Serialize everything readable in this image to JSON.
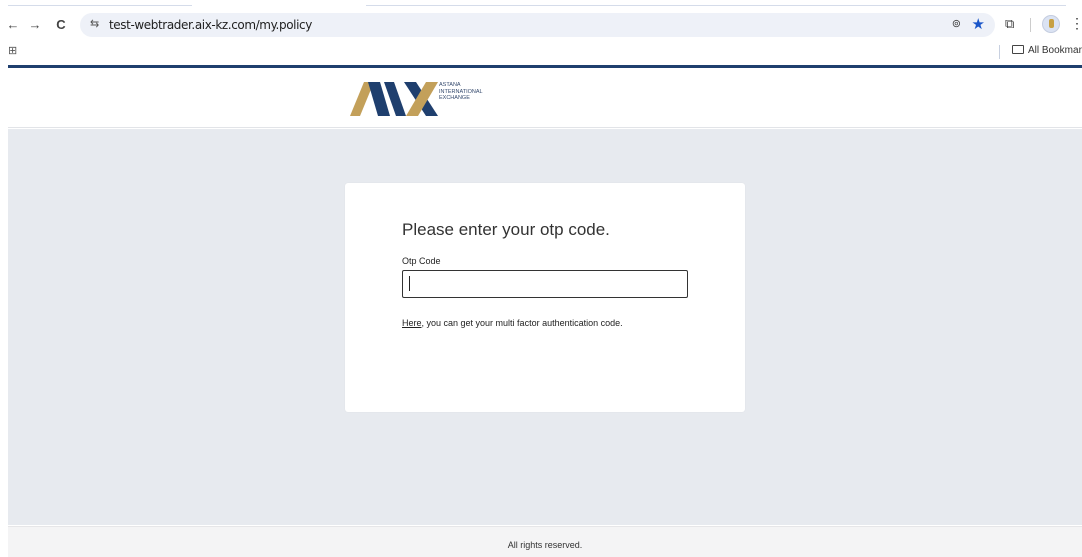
{
  "browser": {
    "url": "test-webtrader.aix-kz.com/my.policy",
    "back_glyph": "←",
    "forward_glyph": "→",
    "reload_glyph": "C",
    "site_info_glyph": "⇆",
    "key_glyph": "⊚",
    "star_glyph": "★",
    "extensions_glyph": "⧉",
    "menu_glyph": "⋮",
    "apps_glyph": "⊞",
    "all_bookmarks_label": "All Bookmarks",
    "accent_color": "#1a56c9"
  },
  "site": {
    "logo_text_line1": "ASTANA",
    "logo_text_line2": "INTERNATIONAL",
    "logo_text_line3": "EXCHANGE",
    "brand_navy": "#1f3f6e",
    "brand_gold": "#c3a05a"
  },
  "card": {
    "title": "Please enter your otp code.",
    "otp_label": "Otp Code",
    "otp_value": "",
    "help_link": "Here",
    "help_text": ", you can get your multi factor authentication code."
  },
  "footer": {
    "text": "All rights reserved."
  }
}
